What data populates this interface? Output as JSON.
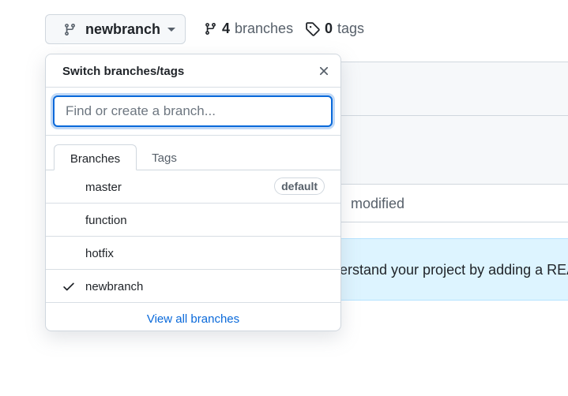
{
  "header": {
    "current_branch": "newbranch",
    "branches_count": "4",
    "branches_label": "branches",
    "tags_count": "0",
    "tags_label": "tags"
  },
  "background": {
    "commit_text": "modified",
    "readme_text": "erstand your project by adding a README"
  },
  "dropdown": {
    "title": "Switch branches/tags",
    "filter_placeholder": "Find or create a branch...",
    "tabs": [
      {
        "label": "Branches",
        "active": true
      },
      {
        "label": "Tags",
        "active": false
      }
    ],
    "branches": [
      {
        "name": "master",
        "badge": "default",
        "selected": false
      },
      {
        "name": "function",
        "badge": "",
        "selected": false
      },
      {
        "name": "hotfix",
        "badge": "",
        "selected": false
      },
      {
        "name": "newbranch",
        "badge": "",
        "selected": true
      }
    ],
    "view_all_label": "View all branches"
  },
  "colors": {
    "accent": "#0969da",
    "readme_bg": "#ddf4ff",
    "border": "#d0d7de"
  },
  "icons": {
    "branch": "git-branch-icon",
    "tag": "tag-icon",
    "close": "close-icon",
    "check": "check-icon",
    "caret": "triangle-down-icon"
  }
}
